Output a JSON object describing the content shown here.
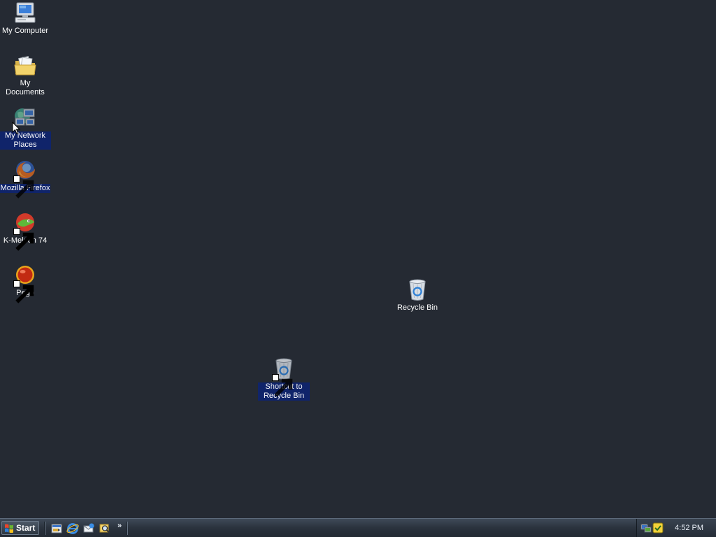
{
  "desktop": {
    "background_color": "#252a33",
    "icons": [
      {
        "label": "My Computer",
        "icon": "computer-icon",
        "shortcut": false
      },
      {
        "label": "My Documents",
        "icon": "folder-documents-icon",
        "shortcut": false
      },
      {
        "label": "My Network Places",
        "icon": "network-places-icon",
        "shortcut": false,
        "selected": true
      },
      {
        "label": "Mozilla Firefox",
        "icon": "firefox-icon",
        "shortcut": true,
        "selected": true
      },
      {
        "label": "K-Meleon 74",
        "icon": "k-meleon-icon",
        "shortcut": true
      },
      {
        "label": "Pego",
        "icon": "pego-icon",
        "shortcut": true
      },
      {
        "label": "Recycle Bin",
        "icon": "recycle-bin-icon",
        "shortcut": false
      },
      {
        "label": "Shortcut to Recycle Bin",
        "icon": "recycle-bin-icon",
        "shortcut": true,
        "selected": true
      }
    ]
  },
  "taskbar": {
    "start_label": "Start",
    "quick_launch": [
      "show-desktop-icon",
      "internet-explorer-icon",
      "outlook-express-icon",
      "search-icon"
    ],
    "overflow_label": "»",
    "tray_icons": [
      "network-icon",
      "security-icon"
    ],
    "clock": "4:52 PM"
  }
}
